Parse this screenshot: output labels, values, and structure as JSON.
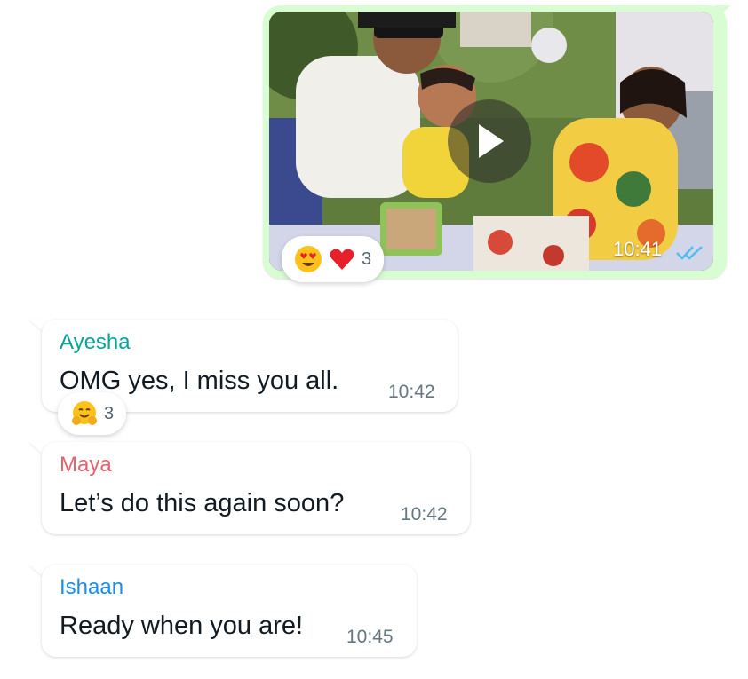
{
  "outgoing_video": {
    "time": "10:41",
    "status_icon": "double-check-read-icon",
    "reactions": {
      "emojis": [
        "heart-eyes-emoji",
        "red-heart-emoji"
      ],
      "count": "3"
    }
  },
  "messages": [
    {
      "sender": "Ayesha",
      "sender_color": "#0aa39a",
      "text": "OMG yes, I miss you all.",
      "time": "10:42",
      "reaction": {
        "emoji": "hugging-face-emoji",
        "count": "3"
      }
    },
    {
      "sender": "Maya",
      "sender_color": "#e5636e",
      "text": "Let’s do this again soon?",
      "time": "10:42"
    },
    {
      "sender": "Ishaan",
      "sender_color": "#1a8ee8",
      "text": "Ready when you are!",
      "time": "10:45"
    }
  ],
  "colors": {
    "outgoing_bubble": "#d9fdd3",
    "incoming_bubble": "#ffffff",
    "read_ticks": "#53bdeb"
  }
}
